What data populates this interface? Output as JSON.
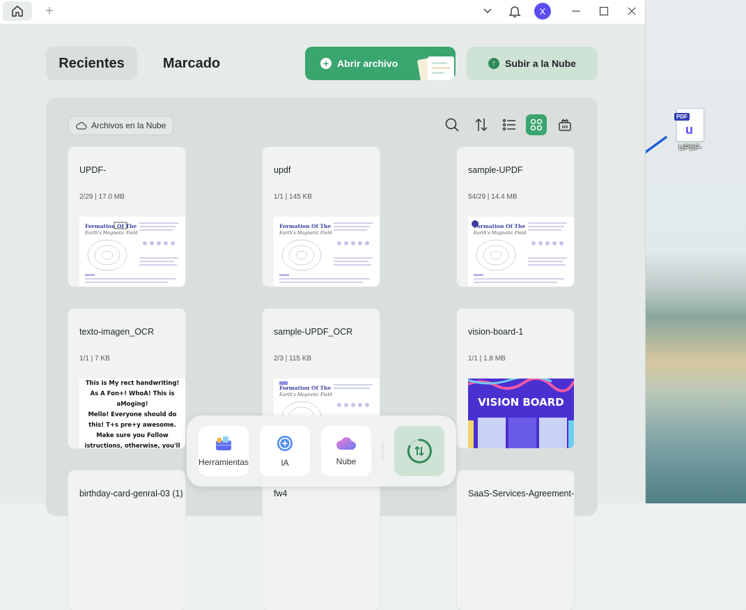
{
  "titlebar": {
    "avatar_letter": "X"
  },
  "segments": {
    "recent": "Recientes",
    "bookmarked": "Marcado"
  },
  "actions": {
    "open_file": "Abrir archivo",
    "upload_cloud": "Subir a la Nube"
  },
  "filter_chip": "Archivos en la Nube",
  "files": [
    {
      "name": "UPDF-",
      "meta": "2/29 | 17.0 MB",
      "thumb": "doc"
    },
    {
      "name": "updf",
      "meta": "1/1 | 145 KB",
      "thumb": "doc"
    },
    {
      "name": "sample-UPDF",
      "meta": "54/29 | 14.4 MB",
      "thumb": "doc"
    },
    {
      "name": "texto-imagen_OCR",
      "meta": "1/1 | 7 KB",
      "thumb": "text",
      "thumb_text": "This is My rect handwriting! As A Fon+! WhoA! This is aMoging!\nMello! Everyone should do this! T+s pre+y awesome. Make sure you Follow istructions, otherwise, you'll have a bad le+rer or number. Sheesh! LOOk a+ my number eigh! s"
    },
    {
      "name": "sample-UPDF_OCR",
      "meta": "2/3 | 115 KB",
      "thumb": "doc"
    },
    {
      "name": "vision-board-1",
      "meta": "1/1 | 1.8 MB",
      "thumb": "vision",
      "thumb_title": "VISION BOARD"
    },
    {
      "name": "birthday-card-genral-03 (1)",
      "meta": "",
      "thumb": "none"
    },
    {
      "name": "fw4",
      "meta": "",
      "thumb": "none"
    },
    {
      "name": "SaaS-Services-Agreement-Template",
      "meta": "",
      "thumb": "none"
    }
  ],
  "thumb_doc_title": "Formation Of The",
  "thumb_doc_subtitle": "Earth's Magnetic Field",
  "dock": {
    "tools": "Herramientas",
    "ai": "IA",
    "cloud": "Nube"
  },
  "desktop": {
    "icon_label": "UPDF-",
    "icon_tag": "PDF"
  },
  "colors": {
    "accent": "#3aa56e",
    "brand": "#5b4df0",
    "vision_board_bg": "#4a2fd1"
  }
}
